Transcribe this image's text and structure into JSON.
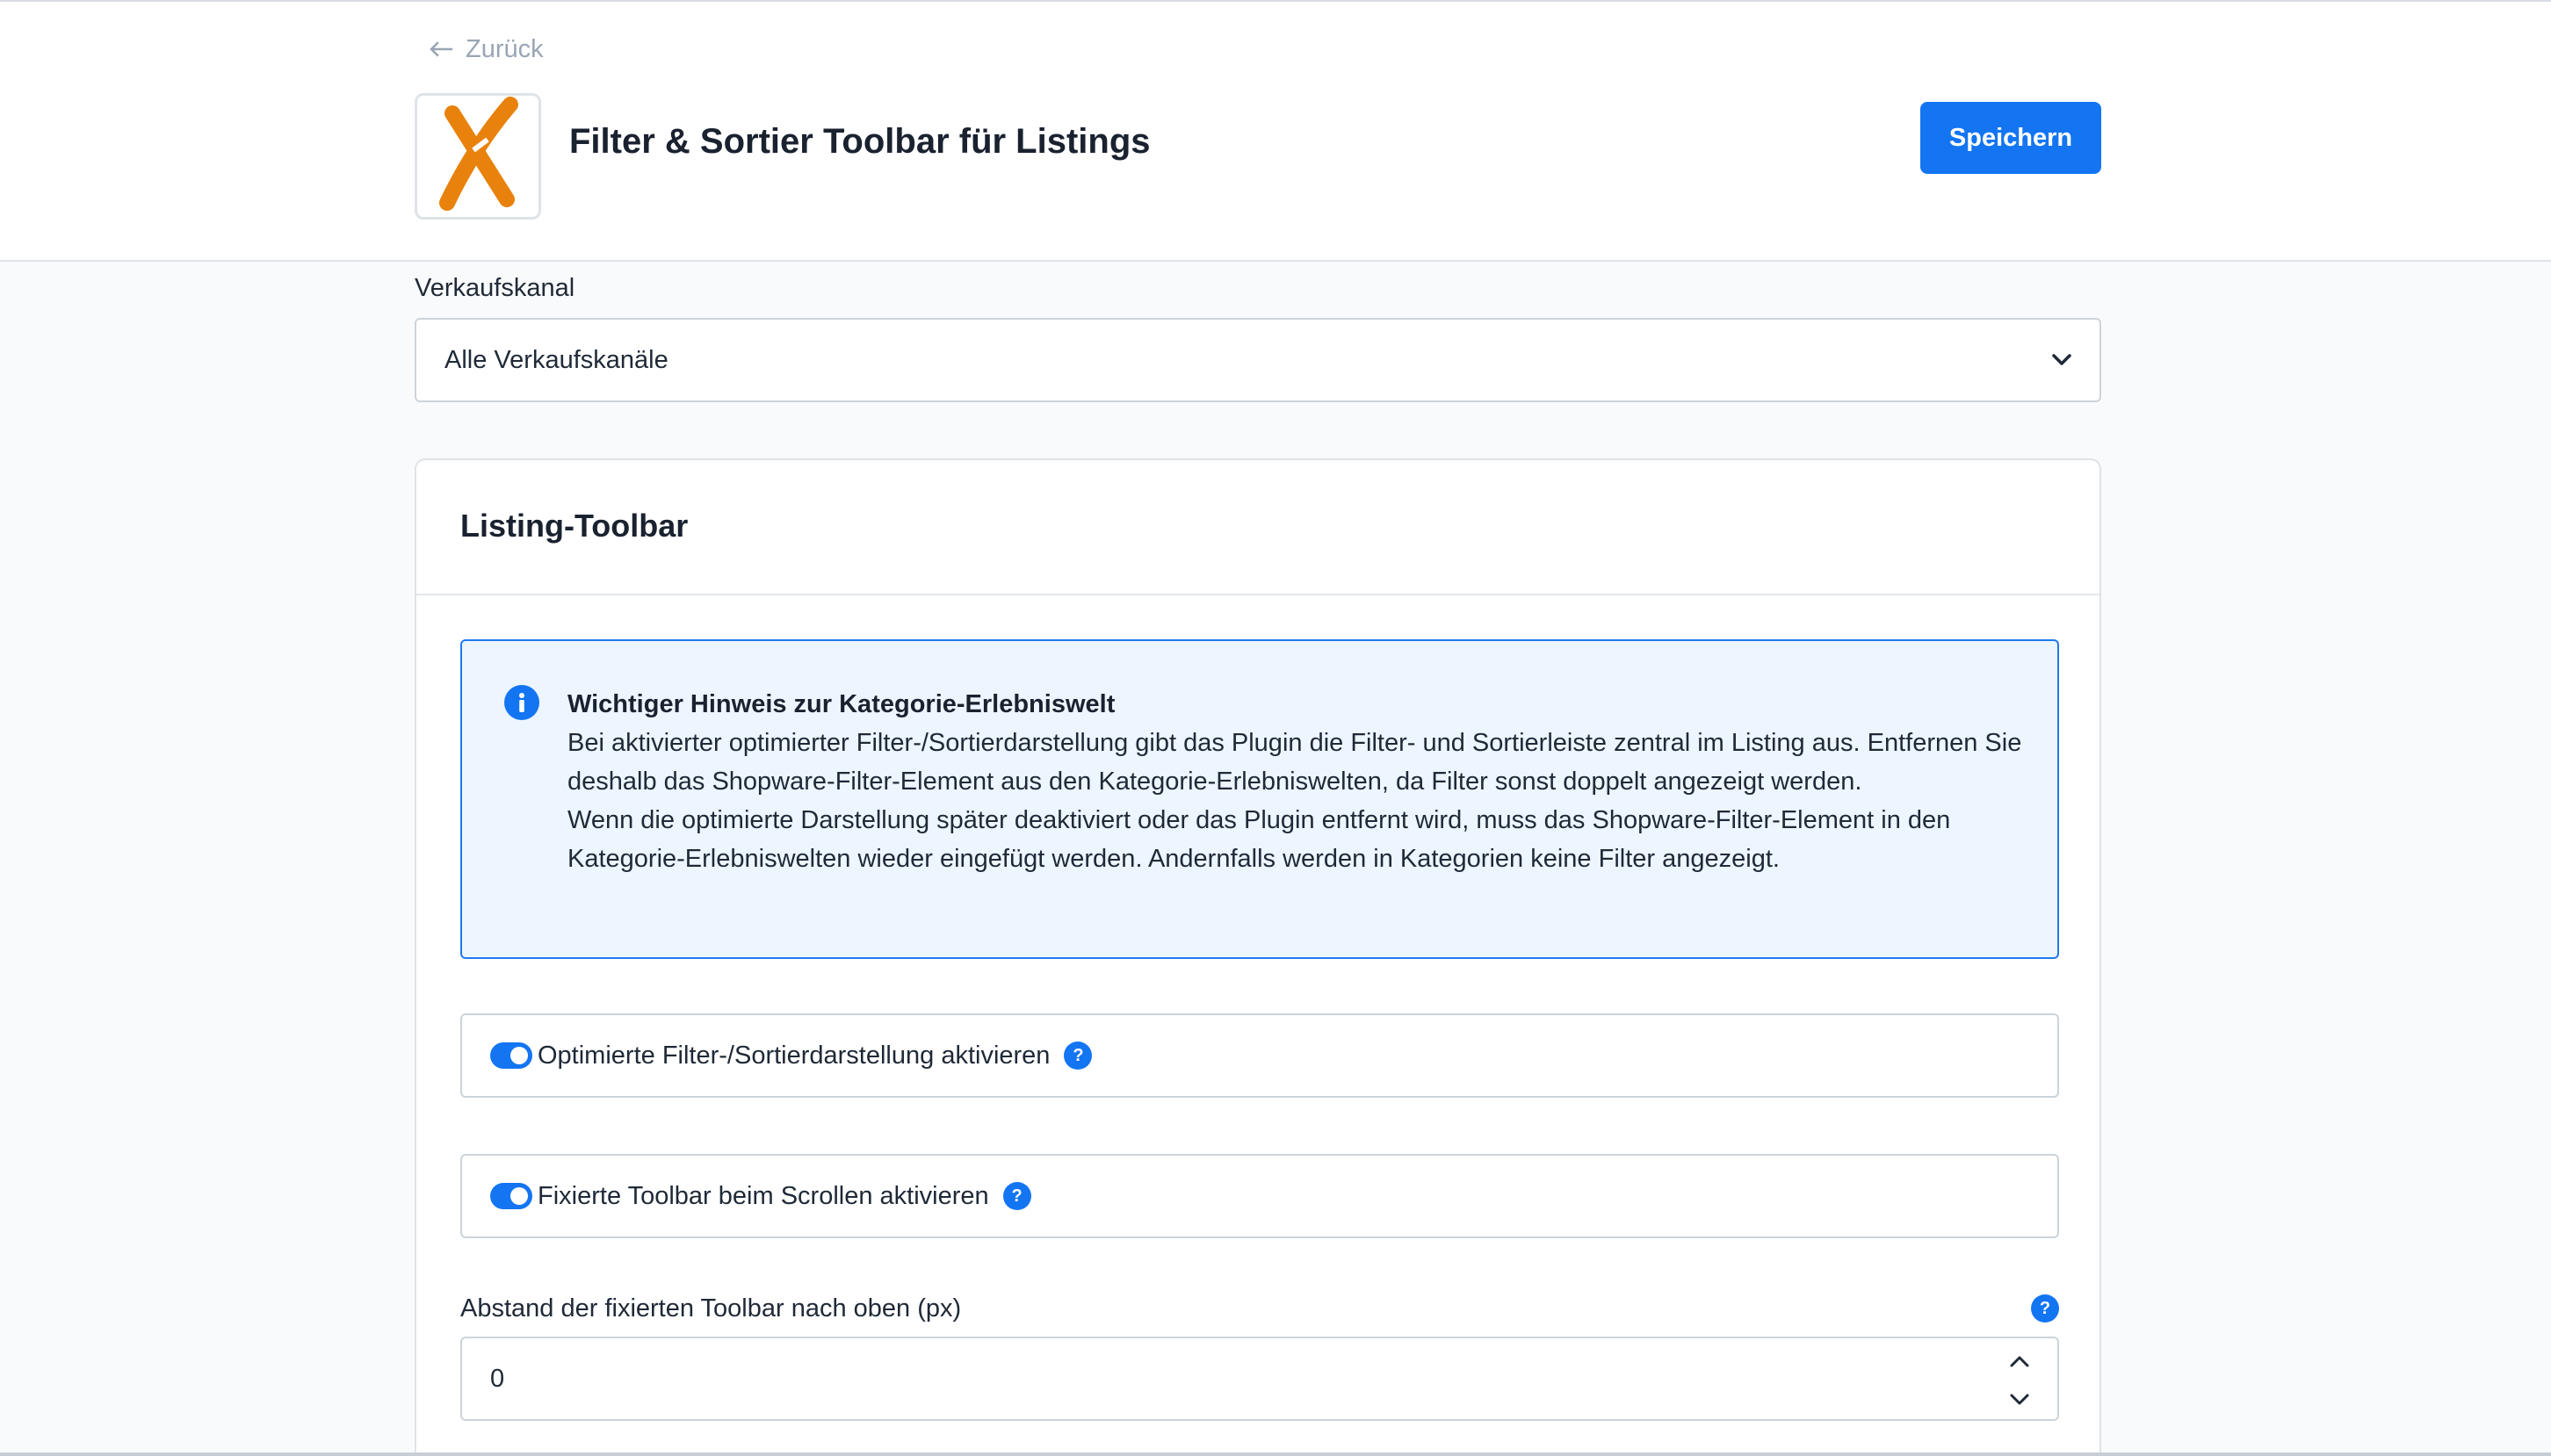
{
  "header": {
    "back_label": "Zurück",
    "title": "Filter & Sortier Toolbar für Listings",
    "save_label": "Speichern",
    "logo_icon": "orange-x-logo"
  },
  "sales_channel": {
    "label": "Verkaufskanal",
    "selected": "Alle Verkaufskanäle"
  },
  "card": {
    "title": "Listing-Toolbar",
    "notice": {
      "title": "Wichtiger Hinweis zur Kategorie-Erlebniswelt",
      "paragraph_1": "Bei aktivierter optimierter Filter-/Sortierdarstellung gibt das Plugin die Filter- und Sortierleiste zentral im Listing aus. Entfernen Sie deshalb das Shopware-Filter-Element aus den Kategorie-Erlebniswelten, da Filter sonst doppelt angezeigt werden.",
      "paragraph_2": "Wenn die optimierte Darstellung später deaktiviert oder das Plugin entfernt wird, muss das Shopware-Filter-Element in den Kategorie-Erlebniswelten wieder eingefügt werden. Andernfalls werden in Kategorien keine Filter angezeigt."
    },
    "toggles": [
      {
        "label": "Optimierte Filter-/Sortierdarstellung aktivieren",
        "enabled": true
      },
      {
        "label": "Fixierte Toolbar beim Scrollen aktivieren",
        "enabled": true
      }
    ],
    "offset_field": {
      "label": "Abstand der fixierten Toolbar nach oben (px)",
      "value": "0"
    },
    "help_glyph": "?"
  },
  "colors": {
    "accent": "#1375f2",
    "logo_orange": "#e8820c",
    "notice_bg": "#edf5ff"
  }
}
